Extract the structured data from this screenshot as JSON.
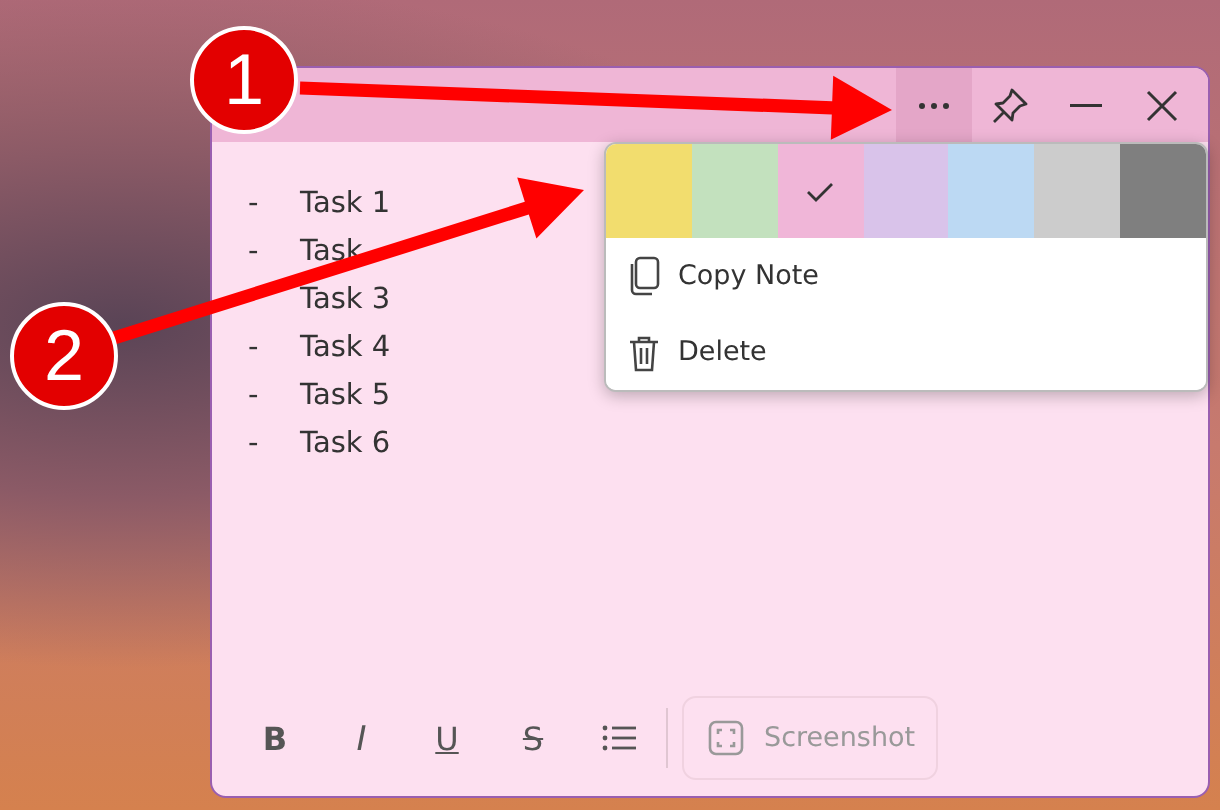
{
  "note": {
    "more_menu_open": true,
    "tasks": [
      {
        "bullet": "-",
        "text": "Task 1"
      },
      {
        "bullet": "-",
        "text": "Task"
      },
      {
        "text": "Task 3"
      },
      {
        "bullet": "-",
        "text": "Task 4"
      },
      {
        "bullet": "-",
        "text": "Task 5"
      },
      {
        "bullet": "-",
        "text": "Task 6"
      }
    ],
    "toolbar": [
      {
        "kind": "bold",
        "label": "B"
      },
      {
        "kind": "italic",
        "label": "I"
      },
      {
        "kind": "underline",
        "label": "U"
      },
      {
        "kind": "strike",
        "label": "S"
      },
      {
        "kind": "list"
      }
    ],
    "screenshot_button": "Screenshot"
  },
  "menu": {
    "swatches": [
      {
        "color": "#f2dd6e",
        "selected": false
      },
      {
        "color": "#c3e1be",
        "selected": false
      },
      {
        "color": "#f0b6d8",
        "selected": true
      },
      {
        "color": "#d9c3ea",
        "selected": false
      },
      {
        "color": "#bcd9f3",
        "selected": false
      },
      {
        "color": "#cccccc",
        "selected": false
      },
      {
        "color": "#7f7f7f",
        "selected": false
      }
    ],
    "items": [
      {
        "kind": "copy",
        "label": "Copy Note"
      },
      {
        "kind": "delete",
        "label": "Delete"
      }
    ]
  },
  "annotations": [
    {
      "label": "1"
    },
    {
      "label": "2"
    }
  ]
}
